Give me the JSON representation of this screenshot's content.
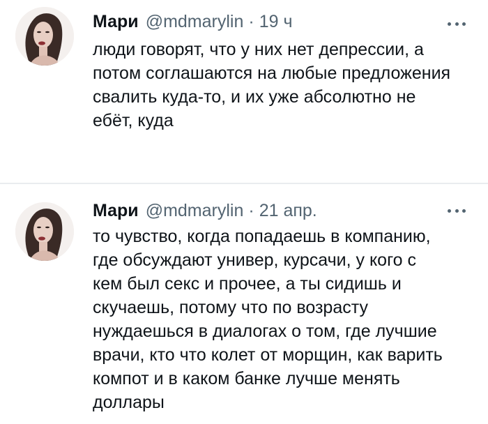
{
  "tweets": [
    {
      "author_name": "Мари",
      "handle": "@mdmarylin",
      "separator": "·",
      "time": "19 ч",
      "text_lines": [
        "люди говорят, что у них нет депрессии, а",
        "потом соглашаются на любые предложения",
        "свалить куда-то, и их уже абсолютно не",
        "ебёт, куда"
      ],
      "avatar_icon": "profile-photo-avatar",
      "more_icon": "more-options-icon"
    },
    {
      "author_name": "Мари",
      "handle": "@mdmarylin",
      "separator": "·",
      "time": "21 апр.",
      "text_lines": [
        "то чувство, когда попадаешь в компанию,",
        "где обсуждают универ, курсачи, у кого с",
        "кем был секс и прочее, а ты сидишь и",
        "скучаешь, потому что по возрасту",
        "нуждаешься в диалогах о том, где лучшие",
        "врачи, кто что колет от морщин, как варить",
        "компот и в каком банке лучше менять",
        "доллары"
      ],
      "avatar_icon": "profile-photo-avatar",
      "more_icon": "more-options-icon"
    }
  ],
  "colors": {
    "text_primary": "#0f1419",
    "text_secondary": "#536471",
    "divider": "#e9ecef",
    "background": "#ffffff"
  }
}
